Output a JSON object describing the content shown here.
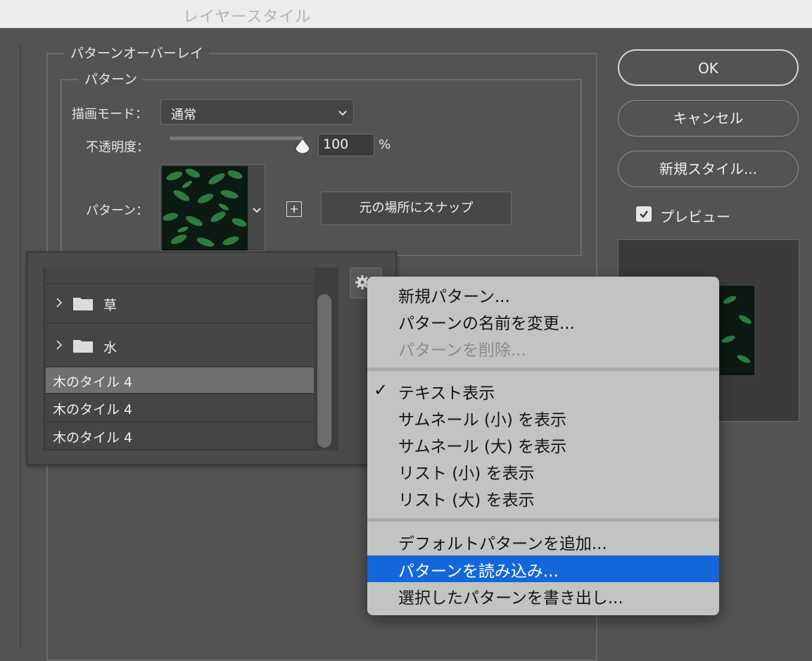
{
  "window": {
    "title": "レイヤースタイル"
  },
  "pattern_overlay": {
    "group_title": "パターンオーバーレイ",
    "pattern_group_title": "パターン",
    "blend_mode_label": "描画モード：",
    "blend_mode_value": "通常",
    "opacity_label": "不透明度：",
    "opacity_value": "100",
    "opacity_unit": "%",
    "opacity_level": 1.0,
    "pattern_label": "パターン：",
    "snap_button": "元の場所にスナップ"
  },
  "buttons": {
    "ok": "OK",
    "cancel": "キャンセル",
    "new_style": "新規スタイル..."
  },
  "preview": {
    "label": "プレビュー",
    "checked": true
  },
  "preset_panel": {
    "folders": [
      {
        "label": "草"
      },
      {
        "label": "水"
      }
    ],
    "items": [
      {
        "label": "木のタイル 4",
        "selected": true
      },
      {
        "label": "木のタイル 4",
        "selected": false
      },
      {
        "label": "木のタイル 4",
        "selected": false
      }
    ]
  },
  "context_menu": {
    "group1": [
      {
        "label": "新規パターン...",
        "enabled": true
      },
      {
        "label": "パターンの名前を変更...",
        "enabled": true
      },
      {
        "label": "パターンを削除...",
        "enabled": false
      }
    ],
    "group2": [
      {
        "label": "テキスト表示",
        "checked": true
      },
      {
        "label": "サムネール (小) を表示",
        "checked": false
      },
      {
        "label": "サムネール (大) を表示",
        "checked": false
      },
      {
        "label": "リスト (小) を表示",
        "checked": false
      },
      {
        "label": "リスト (大) を表示",
        "checked": false
      }
    ],
    "group3": [
      {
        "label": "デフォルトパターンを追加...",
        "highlighted": false
      },
      {
        "label": "パターンを読み込み...",
        "highlighted": true
      },
      {
        "label": "選択したパターンを書き出し...",
        "highlighted": false
      }
    ],
    "checkmark": "✓"
  },
  "colors": {
    "dialog_bg": "#535353",
    "menu_bg": "#c2c4c2",
    "menu_highlight": "#1367db",
    "selected_row": "#707070"
  }
}
